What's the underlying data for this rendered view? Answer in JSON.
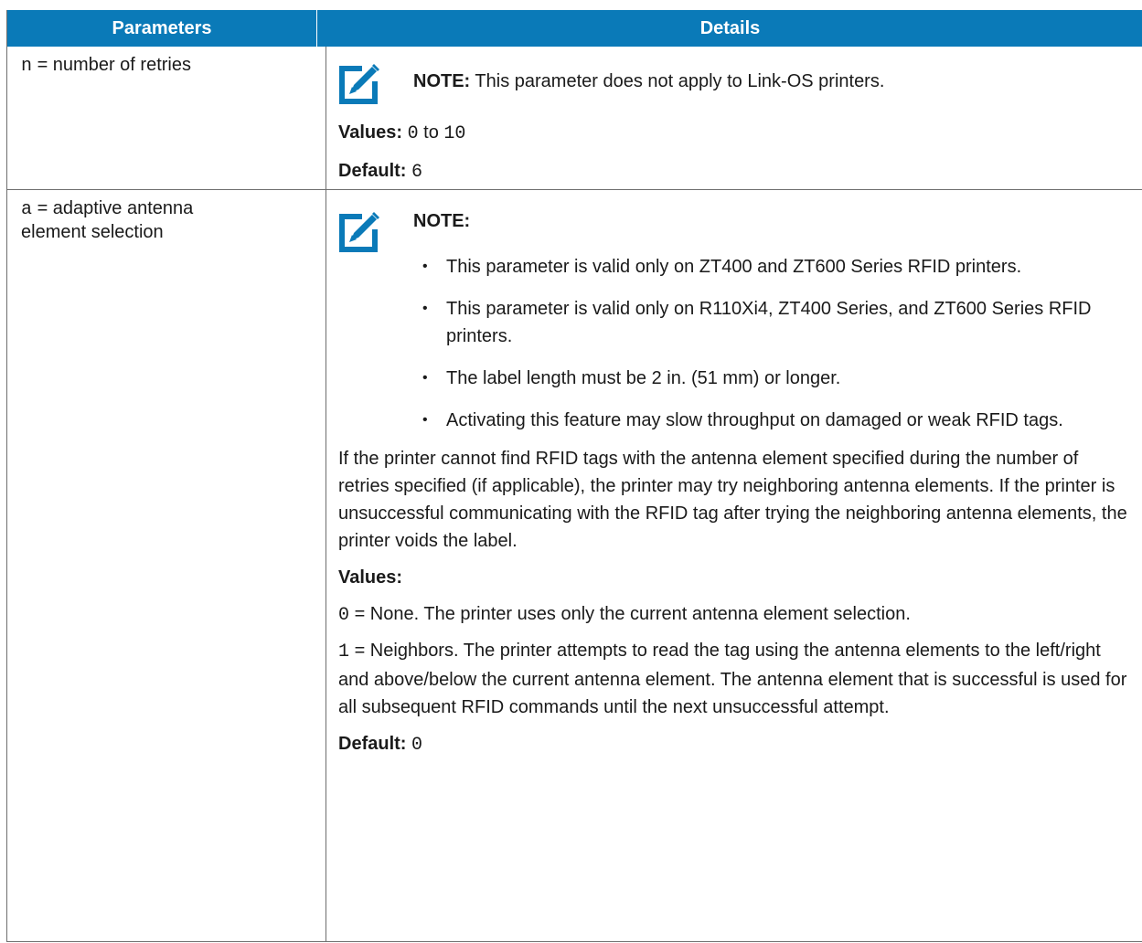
{
  "header": {
    "col1": "Parameters",
    "col2": "Details"
  },
  "row1": {
    "param_code": "n",
    "param_label": " = number of retries",
    "note_label": "NOTE:",
    "note_text": " This parameter does not apply to Link-OS printers.",
    "values_label": "Values:",
    "values_from": "0",
    "values_to_word": " to ",
    "values_to": "10",
    "default_label": "Default:",
    "default_value": "6"
  },
  "row2": {
    "param_code": "a",
    "param_label_line1": " = adaptive antenna",
    "param_label_line2": "element selection",
    "note_label": "NOTE:",
    "bullets": [
      "This parameter is valid only on ZT400 and ZT600 Series RFID printers.",
      "This parameter is valid only on R110Xi4, ZT400 Series, and ZT600 Series RFID printers.",
      "The label length must be 2 in. (51 mm) or longer.",
      "Activating this feature may slow throughput on damaged or weak RFID tags."
    ],
    "paragraph": "If the printer cannot find RFID tags with the antenna element specified during the number of retries specified (if applicable), the printer may try neighboring antenna elements. If the printer is unsuccessful communicating with the RFID tag after trying the neighboring antenna elements, the printer voids the label.",
    "values_label": "Values:",
    "value0_code": "0",
    "value0_text": " = None. The printer uses only the current antenna element selection.",
    "value1_code": "1",
    "value1_text": " = Neighbors. The printer attempts to read the tag using the antenna elements to the left/right and above/below the current antenna element. The antenna element that is successful is used for all subsequent RFID commands until the next unsuccessful attempt.",
    "default_label": "Default:",
    "default_value": "0"
  },
  "colors": {
    "header_bg": "#0a7ab8",
    "note_icon": "#0a7ab8"
  },
  "icons": {
    "note": "note-pencil-icon"
  }
}
